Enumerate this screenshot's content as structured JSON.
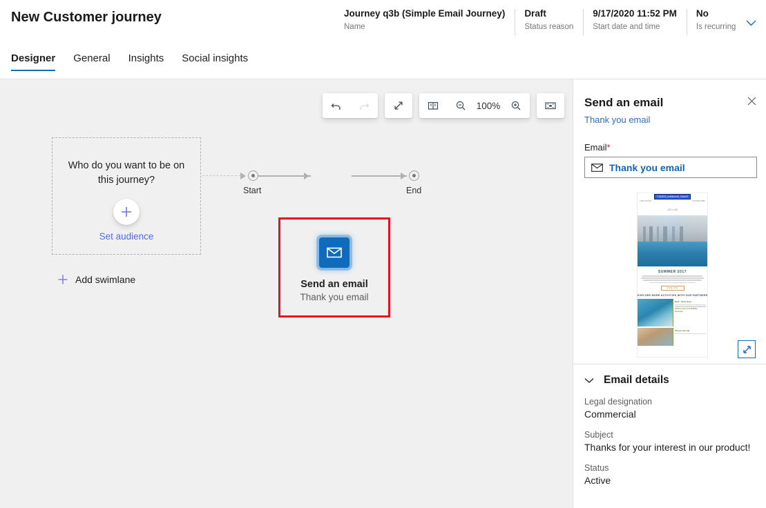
{
  "header": {
    "title": "New Customer journey",
    "meta": [
      {
        "value": "Journey q3b (Simple Email Journey)",
        "label": "Name"
      },
      {
        "value": "Draft",
        "label": "Status reason"
      },
      {
        "value": "9/17/2020 11:52 PM",
        "label": "Start date and time"
      },
      {
        "value": "No",
        "label": "Is recurring"
      }
    ],
    "chevron_icon": "chevron-down-icon"
  },
  "tabs": [
    {
      "label": "Designer",
      "active": true
    },
    {
      "label": "General",
      "active": false
    },
    {
      "label": "Insights",
      "active": false
    },
    {
      "label": "Social insights",
      "active": false
    }
  ],
  "toolbar": {
    "undo_label": "undo-icon",
    "redo_label": "redo-icon",
    "expand_label": "expand-diagonal-icon",
    "map_label": "map-icon",
    "zoom_out_label": "zoom-out-icon",
    "zoom_level": "100%",
    "zoom_in_label": "zoom-in-icon",
    "fit_label": "fit-to-screen-icon"
  },
  "canvas": {
    "swimlane": {
      "question": "Who do you want to be on this journey?",
      "plus_icon": "plus-icon",
      "set_audience_label": "Set audience"
    },
    "add_swimlane_label": "Add swimlane",
    "start_label": "Start",
    "end_label": "End",
    "tile": {
      "icon": "envelope-icon",
      "title": "Send an email",
      "subtitle": "Thank you email",
      "selection_color": "#e81123",
      "tile_color": "#0f6cbd"
    }
  },
  "panel": {
    "title": "Send an email",
    "subtitle": "Thank you email",
    "close_icon": "close-icon",
    "email_field_label": "Email",
    "required_marker": "*",
    "email_field_icon": "envelope-icon",
    "email_field_value": "Thank you email",
    "preview": {
      "top_link": "F180515_entitlement_0Utm2f",
      "row_left": "VIEW ONLINE",
      "row_right": "UNSUBSCRIBE",
      "dimension_placeholder": "120 x 60",
      "summer_title": "SUMMER 2017",
      "more_info_button": "MORE INFO",
      "explore_heading": "EXPLORE MORE ACTIVITIES WITH OUR PARTNERS",
      "card1_title": "Park - three days",
      "card1_cta": "Check prices & availability",
      "card1_price": "€preise/g",
      "card2_title": "All you can eat",
      "expand_icon": "expand-diagonal-icon"
    },
    "details": {
      "collapse_icon": "chevron-down-icon",
      "heading": "Email details",
      "fields": [
        {
          "label": "Legal designation",
          "value": "Commercial"
        },
        {
          "label": "Subject",
          "value": "Thanks for your interest in our product!"
        },
        {
          "label": "Status",
          "value": "Active"
        }
      ]
    }
  }
}
